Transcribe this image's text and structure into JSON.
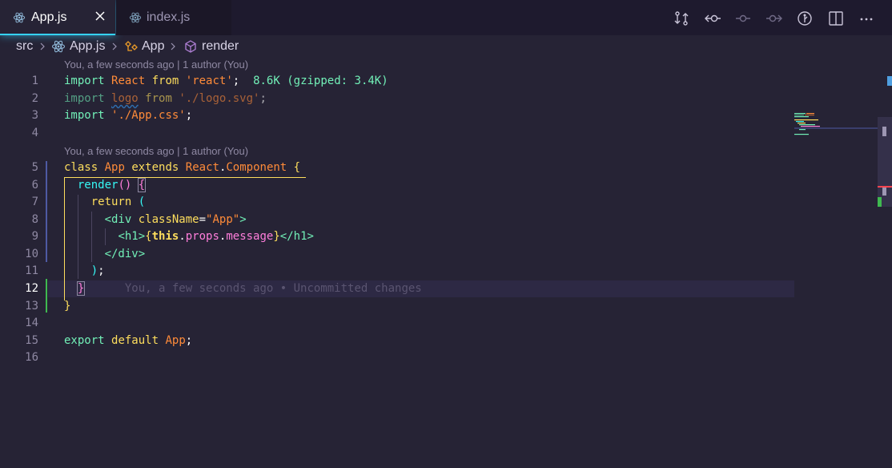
{
  "tabs": [
    {
      "label": "App.js",
      "active": true,
      "icon": "react-icon"
    },
    {
      "label": "index.js",
      "active": false,
      "icon": "react-icon"
    }
  ],
  "breadcrumb": {
    "items": [
      "src",
      "App.js",
      "App",
      "render"
    ]
  },
  "editor": {
    "lens": [
      "You, a few seconds ago | 1 author (You)",
      "You, a few seconds ago | 1 author (You)"
    ],
    "line_numbers": [
      "1",
      "2",
      "3",
      "4",
      "5",
      "6",
      "7",
      "8",
      "9",
      "10",
      "11",
      "12",
      "13",
      "14",
      "15",
      "16"
    ],
    "current_line": "12",
    "import_cost": "8.6K (gzipped: 3.4K)",
    "blame_text": "You, a few seconds ago • Uncommitted changes"
  },
  "colors": {
    "accent": "#35d3ff",
    "background": "#262335",
    "keyword": "#72f1b8",
    "string": "#ff8b39",
    "highlight": "#fede5d",
    "property": "#ff7edb"
  }
}
